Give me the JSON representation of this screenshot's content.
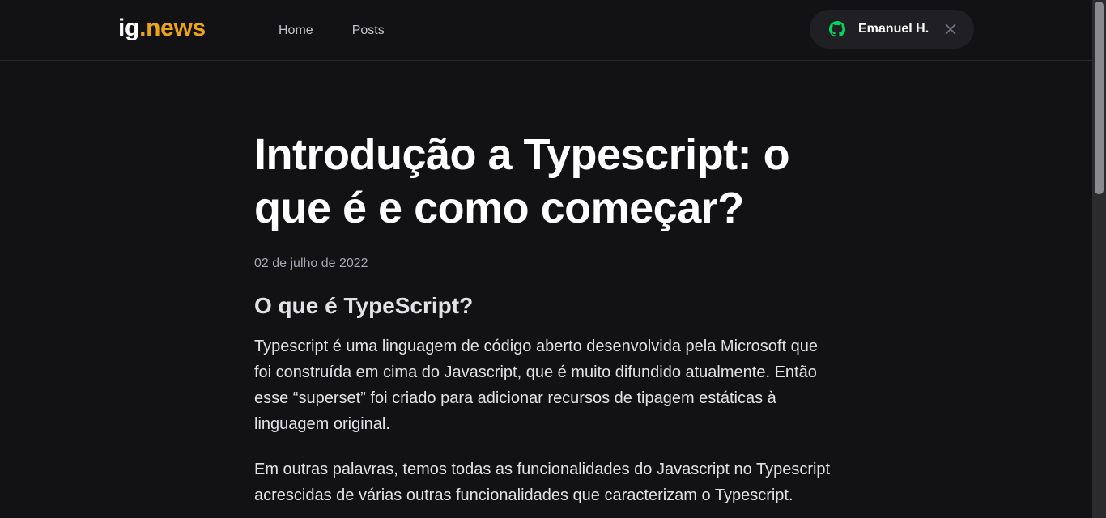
{
  "header": {
    "logo_text": "ig",
    "logo_accent": ".news",
    "nav": [
      {
        "label": "Home"
      },
      {
        "label": "Posts"
      }
    ],
    "user": {
      "name": "Emanuel H.",
      "icon": "github-icon",
      "close_icon": "close-icon"
    }
  },
  "article": {
    "title": "Introdução a Typescript: o que é e como começar?",
    "date": "02 de julho de 2022",
    "heading": "O que é TypeScript?",
    "paragraphs": [
      "Typescript é uma linguagem de código aberto desenvolvida pela Microsoft que foi construída em cima do Javascript, que é muito difundido atualmente. Então esse “superset” foi criado para adicionar recursos de tipagem estáticas à linguagem original.",
      "Em outras palavras, temos todas as funcionalidades do Javascript no Typescript acrescidas de várias outras funcionalidades que caracterizam o Typescript."
    ]
  },
  "colors": {
    "background": "#121214",
    "accent": "#eba417",
    "github_green": "#04d361",
    "pill": "#202024"
  }
}
